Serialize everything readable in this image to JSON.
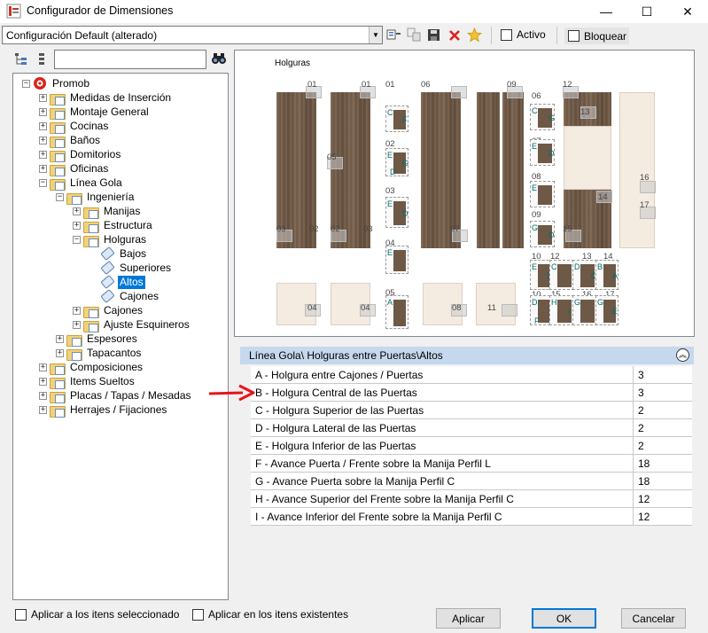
{
  "window": {
    "title": "Configurador de Dimensiones",
    "minimize_glyph": "—",
    "maximize_glyph": "☐",
    "close_glyph": "✕"
  },
  "toolbar": {
    "config_select_value": "Configuración Default (alterado)",
    "icons": [
      "configure-icon",
      "copy-icon",
      "save-icon",
      "delete-icon",
      "favorite-star-icon"
    ],
    "activo_label": "Activo",
    "bloquear_label": "Bloquear"
  },
  "tree": {
    "search_value": "",
    "root": "Promob",
    "items": [
      {
        "label": "Medidas de Inserción",
        "level": 1,
        "expander": "+",
        "icon": "folder"
      },
      {
        "label": "Montaje General",
        "level": 1,
        "expander": "+",
        "icon": "folder"
      },
      {
        "label": "Cocinas",
        "level": 1,
        "expander": "+",
        "icon": "folder"
      },
      {
        "label": "Baños",
        "level": 1,
        "expander": "+",
        "icon": "folder"
      },
      {
        "label": "Domitorios",
        "level": 1,
        "expander": "+",
        "icon": "folder"
      },
      {
        "label": "Oficinas",
        "level": 1,
        "expander": "+",
        "icon": "folder"
      },
      {
        "label": "Línea Gola",
        "level": 1,
        "expander": "−",
        "icon": "folder"
      },
      {
        "label": "Ingeniería",
        "level": 2,
        "expander": "−",
        "icon": "folder"
      },
      {
        "label": "Manijas",
        "level": 3,
        "expander": "+",
        "icon": "folder"
      },
      {
        "label": "Estructura",
        "level": 3,
        "expander": "+",
        "icon": "folder"
      },
      {
        "label": "Holguras",
        "level": 3,
        "expander": "−",
        "icon": "folder"
      },
      {
        "label": "Bajos",
        "level": 4,
        "expander": "",
        "icon": "tag"
      },
      {
        "label": "Superiores",
        "level": 4,
        "expander": "",
        "icon": "tag"
      },
      {
        "label": "Altos",
        "level": 4,
        "expander": "",
        "icon": "tag",
        "selected": true
      },
      {
        "label": "Cajones",
        "level": 4,
        "expander": "",
        "icon": "tag"
      },
      {
        "label": "Cajones",
        "level": 3,
        "expander": "+",
        "icon": "folder"
      },
      {
        "label": "Ajuste Esquineros",
        "level": 3,
        "expander": "+",
        "icon": "folder"
      },
      {
        "label": "Espesores",
        "level": 2,
        "expander": "+",
        "icon": "folder"
      },
      {
        "label": "Tapacantos",
        "level": 2,
        "expander": "+",
        "icon": "folder"
      },
      {
        "label": "Composiciones",
        "level": 1,
        "expander": "+",
        "icon": "folder"
      },
      {
        "label": "Items Sueltos",
        "level": 1,
        "expander": "+",
        "icon": "folder"
      },
      {
        "label": "Placas / Tapas / Mesadas",
        "level": 1,
        "expander": "+",
        "icon": "folder"
      },
      {
        "label": "Herrajes / Fijaciones",
        "level": 1,
        "expander": "+",
        "icon": "folder"
      }
    ]
  },
  "preview": {
    "title": "Holguras",
    "labels": [
      "01",
      "01",
      "06",
      "09",
      "12",
      "05",
      "03",
      "02",
      "03",
      "02",
      "07",
      "15",
      "04",
      "04",
      "08",
      "11",
      "01",
      "02",
      "03",
      "04",
      "05",
      "06",
      "07",
      "08",
      "09",
      "10",
      "12",
      "13",
      "14",
      "10",
      "15",
      "16",
      "17",
      "16",
      "17",
      "13",
      "14"
    ],
    "detail_letters": [
      "C",
      "F",
      "E",
      "G",
      "D",
      "E",
      "D",
      "E",
      "A",
      "C",
      "G",
      "E",
      "D",
      "E",
      "G",
      "D",
      "E",
      "D",
      "C",
      "D",
      "C",
      "B",
      "A",
      "D",
      "E",
      "F",
      "H",
      "I",
      "G",
      "G",
      "E"
    ]
  },
  "properties": {
    "header": "Línea Gola\\ Holguras entre Puertas\\Altos",
    "collapse_glyph": "︽",
    "rows": [
      {
        "label": "A - Holgura entre Cajones / Puertas",
        "value": "3"
      },
      {
        "label": "B - Holgura Central de las Puertas",
        "value": "3"
      },
      {
        "label": "C - Holgura Superior de las Puertas",
        "value": "2"
      },
      {
        "label": "D - Holgura Lateral de las Puertas",
        "value": "2"
      },
      {
        "label": "E - Holgura Inferior de las Puertas",
        "value": "2"
      },
      {
        "label": "F - Avance Puerta / Frente sobre la Manija Perfil L",
        "value": "18"
      },
      {
        "label": "G - Avance Puerta sobre la Manija Perfil C",
        "value": "18"
      },
      {
        "label": "H - Avance Superior del Frente sobre la Manija Perfil C",
        "value": "12"
      },
      {
        "label": "I - Avance Inferior del Frente sobre la Manija Perfil C",
        "value": "12"
      }
    ],
    "highlighted_row": "B - Holgura Central de las Puertas",
    "arrow_color": "#e8141b"
  },
  "footer": {
    "apply_selected_label": "Aplicar a los itens seleccionado",
    "apply_existing_label": "Aplicar en los itens existentes",
    "aplicar_label": "Aplicar",
    "ok_label": "OK",
    "cancel_label": "Cancelar"
  }
}
